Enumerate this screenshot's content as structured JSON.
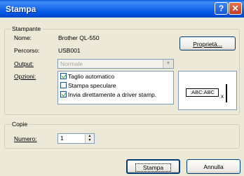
{
  "title": "Stampa",
  "help_button": "?",
  "close_button": "✕",
  "printer_group": {
    "legend": "Stampante",
    "name_label": "Nome:",
    "name_value": "Brother QL-550",
    "path_label": "Percorso:",
    "path_value": "USB001",
    "output_label": "Output:",
    "output_value": "Normale",
    "options_label": "Opzioni:",
    "properties_button": "Proprietà..."
  },
  "options": [
    {
      "label": "Taglio automatico",
      "checked": true
    },
    {
      "label": "Stampa speculare",
      "checked": false
    },
    {
      "label": "Invia direttamente a driver stamp.",
      "checked": true
    }
  ],
  "preview": {
    "sample_text": ":ABC:ABC",
    "x_mark": "x"
  },
  "copies_group": {
    "legend": "Copie",
    "number_label": "Numero:",
    "number_value": "1"
  },
  "buttons": {
    "print": "Stampa",
    "cancel": "Annulla"
  }
}
